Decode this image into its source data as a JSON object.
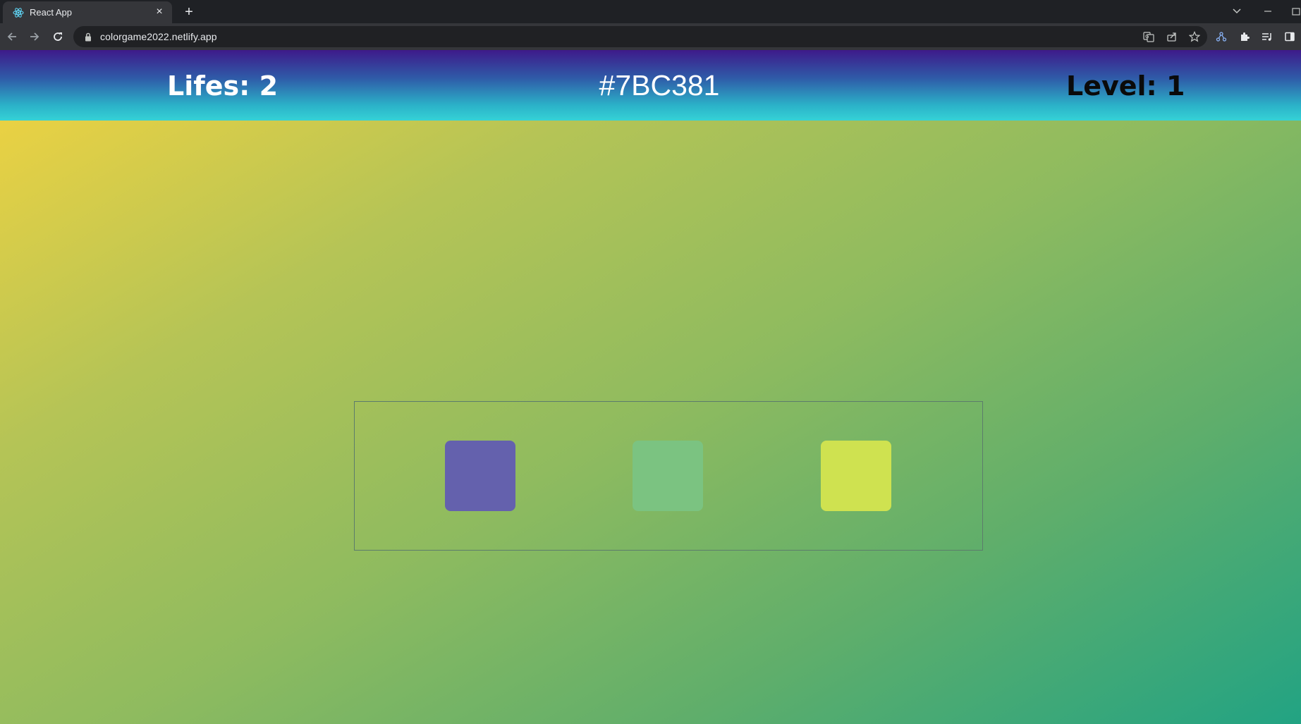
{
  "browser": {
    "tab": {
      "title": "React App",
      "favicon": "react-icon",
      "close": "×"
    },
    "new_tab": "+",
    "address": {
      "url": "colorgame2022.netlify.app"
    },
    "colors": {
      "tabstrip_bg": "#1f2125",
      "toolbar_bg": "#35363a",
      "omnibox_bg": "#202124",
      "icon_fg": "#c4c7c5"
    }
  },
  "game": {
    "lifes_text": "Lifes: 2",
    "target_color_text": "#7BC381",
    "level_text": "Level: 1",
    "options": [
      {
        "color": "#6461ad"
      },
      {
        "color": "#7bc381"
      },
      {
        "color": "#cfe250"
      }
    ],
    "colors": {
      "header_gradient": [
        "#3e1a8a",
        "#2bb1c8",
        "#35d2d6"
      ],
      "background_gradient": [
        "#f5d43f",
        "#8fbb5f",
        "#22a383"
      ],
      "lifes_text_color": "#ffffff",
      "level_text_color": "#0a0a0a"
    }
  }
}
